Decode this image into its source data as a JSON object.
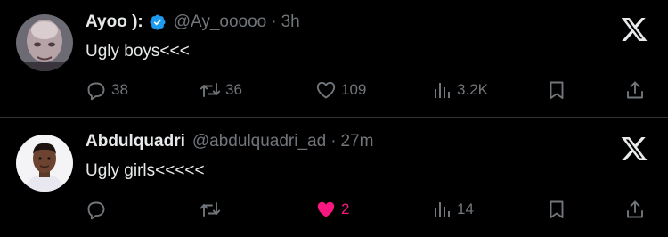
{
  "tweets": [
    {
      "name": "Ayoo ):",
      "verified": true,
      "handle": "@Ay_ooooo",
      "separator": "·",
      "time": "3h",
      "text": "Ugly boys<<<",
      "replies": "38",
      "retweets": "36",
      "likes": "109",
      "liked": false,
      "views": "3.2K"
    },
    {
      "name": "Abdulquadri",
      "verified": false,
      "handle": "@abdulquadri_ad",
      "separator": "·",
      "time": "27m",
      "text": "Ugly girls<<<<<",
      "replies": "",
      "retweets": "",
      "likes": "2",
      "liked": true,
      "views": "14"
    }
  ],
  "colors": {
    "background": "#000000",
    "text": "#e7e9ea",
    "muted": "#71767b",
    "verified": "#1d9bf0",
    "like_active": "#f91880",
    "divider": "#2f3336"
  },
  "icons": [
    "reply-icon",
    "retweet-icon",
    "like-icon",
    "views-icon",
    "bookmark-icon",
    "share-icon",
    "x-logo-icon",
    "verified-badge-icon"
  ]
}
